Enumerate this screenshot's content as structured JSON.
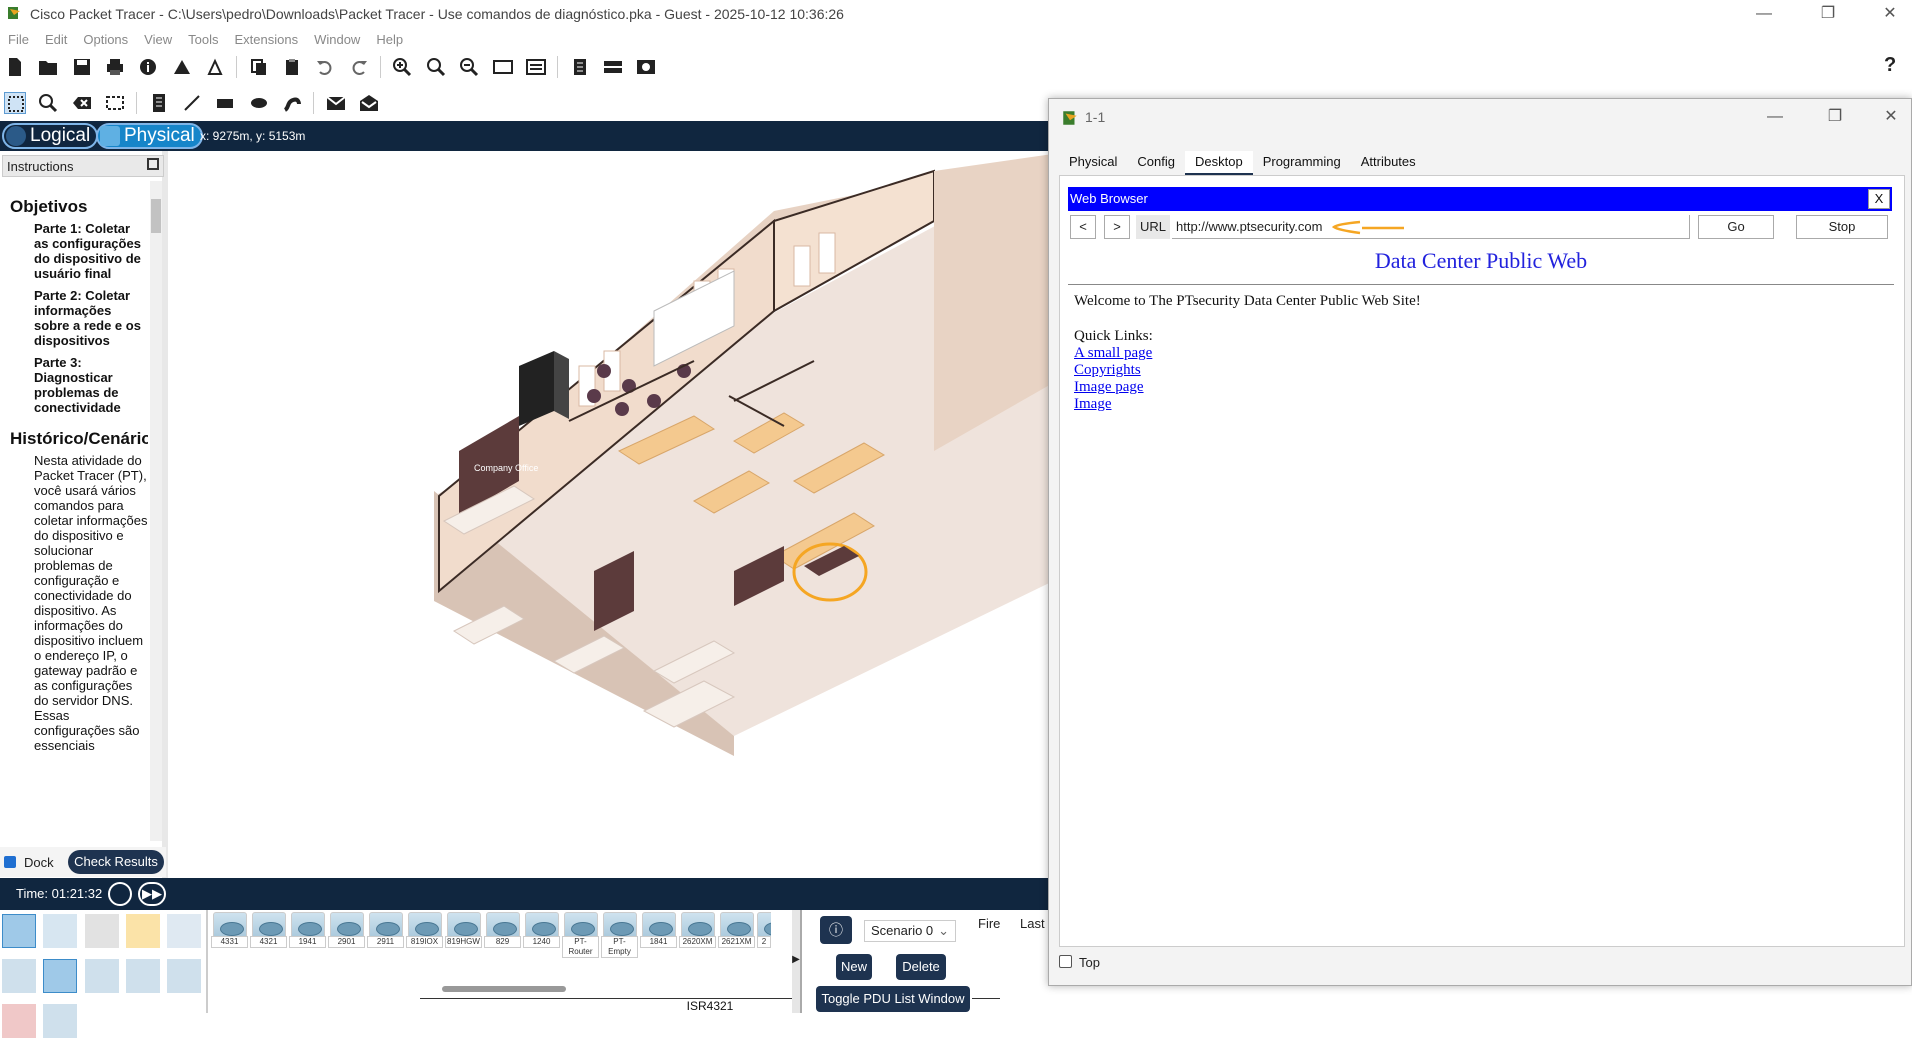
{
  "window": {
    "title": "Cisco Packet Tracer - C:\\Users\\pedro\\Downloads\\Packet Tracer - Use comandos de diagnóstico.pka - Guest - 2025-10-12 10:36:26",
    "minimize": "—",
    "maximize": "❐",
    "close": "✕"
  },
  "menu": [
    "File",
    "Edit",
    "Options",
    "View",
    "Tools",
    "Extensions",
    "Window",
    "Help"
  ],
  "help_glyph": "?",
  "nav": {
    "logical": "Logical",
    "physical": "Physical",
    "coords": "x: 9275m, y: 5153m"
  },
  "instructions": {
    "header": "Instructions",
    "h_objectives": "Objetivos",
    "parts": [
      "Parte 1: Coletar as configurações do dispositivo de usuário final",
      "Parte 2: Coletar informações sobre a rede e os dispositivos",
      "Parte 3: Diagnosticar problemas de conectividade"
    ],
    "h_history": "Histórico/Cenário",
    "text": "Nesta atividade do Packet Tracer (PT), você usará vários comandos para coletar informações do dispositivo e solucionar problemas de configuração e conectividade do dispositivo. As informações do dispositivo incluem o endereço IP, o gateway padrão e as configurações do servidor DNS. Essas configurações são essenciais",
    "dock": "Dock",
    "check_results": "Check Results"
  },
  "time": {
    "label": "Time: 01:21:32"
  },
  "devices": [
    "4331",
    "4321",
    "1941",
    "2901",
    "2911",
    "819IOX",
    "819HGW",
    "829",
    "1240",
    "PT-Router",
    "PT-Empty",
    "1841",
    "2620XM",
    "2621XM",
    "2"
  ],
  "selected_device": "ISR4321",
  "sim": {
    "scenario": "Scenario 0",
    "new": "New",
    "delete": "Delete",
    "toggle": "Toggle PDU List Window",
    "col_fire": "Fire",
    "col_last": "Last"
  },
  "dialog": {
    "title": "1-1",
    "tabs": [
      "Physical",
      "Config",
      "Desktop",
      "Programming",
      "Attributes"
    ],
    "selected_tab": "Desktop",
    "browser_title": "Web Browser",
    "close_x": "X",
    "back": "<",
    "forward": ">",
    "url_label": "URL",
    "url": "http://www.ptsecurity.com",
    "go": "Go",
    "stop": "Stop",
    "top_checkbox": "Top"
  },
  "webpage": {
    "heading": "Data Center Public Web",
    "welcome": "Welcome to The PTsecurity Data Center Public Web Site!",
    "quick_links_label": "Quick Links:",
    "links": [
      "A small page",
      "Copyrights",
      "Image page",
      "Image"
    ]
  },
  "colors": {
    "navy": "#10263f",
    "browser_bar": "#0000ff",
    "link": "#0000ee",
    "annotation": "#f5a623"
  }
}
